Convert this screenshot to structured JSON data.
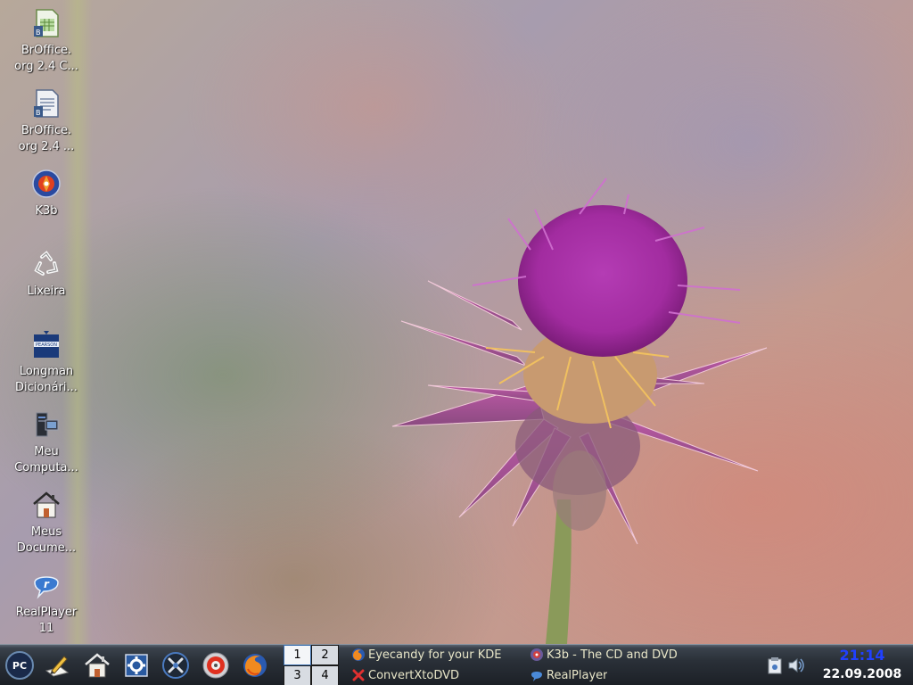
{
  "desktop": {
    "icons": [
      {
        "name": "broffice-calc",
        "label": "BrOffice.\norg 2.4 C..."
      },
      {
        "name": "broffice-writer",
        "label": "BrOffice.\norg 2.4 ..."
      },
      {
        "name": "k3b",
        "label": "K3b"
      },
      {
        "name": "lixeira",
        "label": "Lixeira"
      },
      {
        "name": "longman",
        "label": "Longman\nDicionári..."
      },
      {
        "name": "meu-computador",
        "label": "Meu\nComputa..."
      },
      {
        "name": "meus-documentos",
        "label": "Meus\nDocume..."
      },
      {
        "name": "realplayer",
        "label": "RealPlayer\n11"
      }
    ],
    "longman_logo_text": "PEARSON"
  },
  "taskbar": {
    "launchers": [
      {
        "name": "pc-menu",
        "label": "PC"
      },
      {
        "name": "text-editor"
      },
      {
        "name": "home-folder"
      },
      {
        "name": "control-center"
      },
      {
        "name": "tools"
      },
      {
        "name": "k3b"
      },
      {
        "name": "firefox"
      }
    ],
    "pager": [
      "1",
      "2",
      "3",
      "4"
    ],
    "active_desktop": "1",
    "tasks": [
      {
        "label": "Eyecandy for your KDE",
        "icon": "firefox-icon"
      },
      {
        "label": "K3b - The CD and DVD",
        "icon": "k3b-icon"
      },
      {
        "label": "ConvertXtoDVD",
        "icon": "convertx-icon"
      },
      {
        "label": "RealPlayer",
        "icon": "realplayer-icon"
      }
    ],
    "tray": [
      "klipper-icon",
      "volume-icon"
    ],
    "clock": {
      "time": "21:14",
      "date": "22.09.2008"
    }
  },
  "colors": {
    "clock_time": "#2040ff",
    "task_text": "#e8e6c8"
  }
}
